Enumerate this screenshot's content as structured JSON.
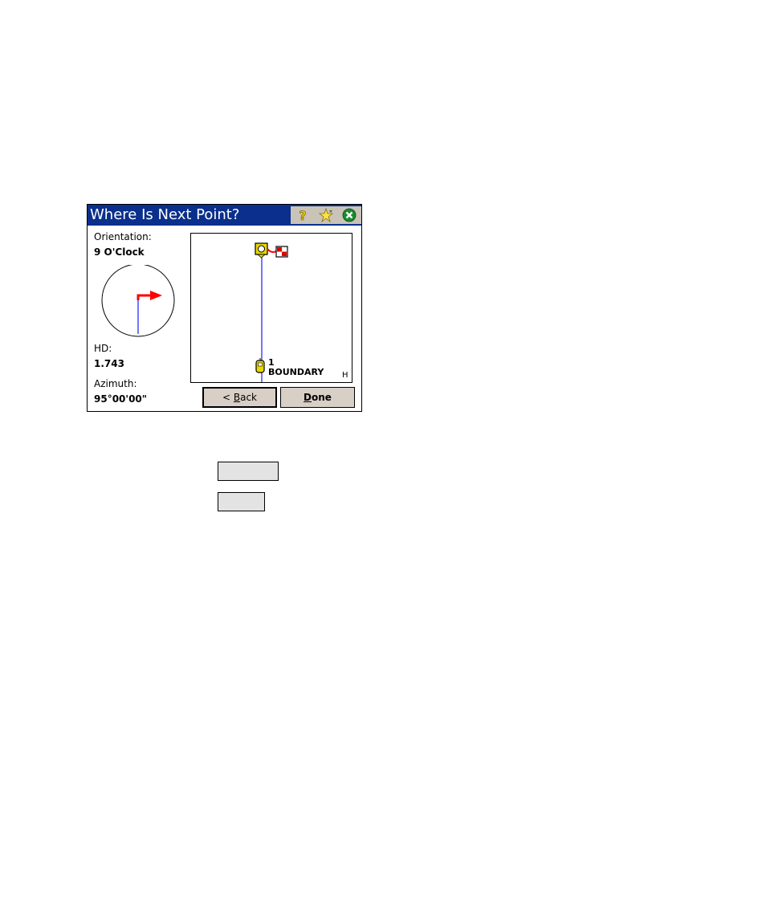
{
  "window": {
    "title": "Where Is Next Point?",
    "title_icons": [
      "help-icon",
      "favorites-star-icon",
      "close-icon"
    ]
  },
  "orientation": {
    "label": "Orientation:",
    "value": "9 O'Clock"
  },
  "hd": {
    "label": "HD:",
    "value": "1.743"
  },
  "azimuth": {
    "label": "Azimuth:",
    "value": "95°00'00\""
  },
  "map": {
    "point_number": "1",
    "point_name": "BOUNDARY",
    "view_label": "H"
  },
  "buttons": {
    "back": {
      "prefix": "< ",
      "accel": "B",
      "rest": "ack"
    },
    "done": {
      "accel": "D",
      "rest": "one"
    }
  },
  "colors": {
    "titlebar": "#0a2f8c",
    "line": "#1a1aff",
    "arrow": "#ff0000",
    "button_face": "#d8cfc6"
  }
}
